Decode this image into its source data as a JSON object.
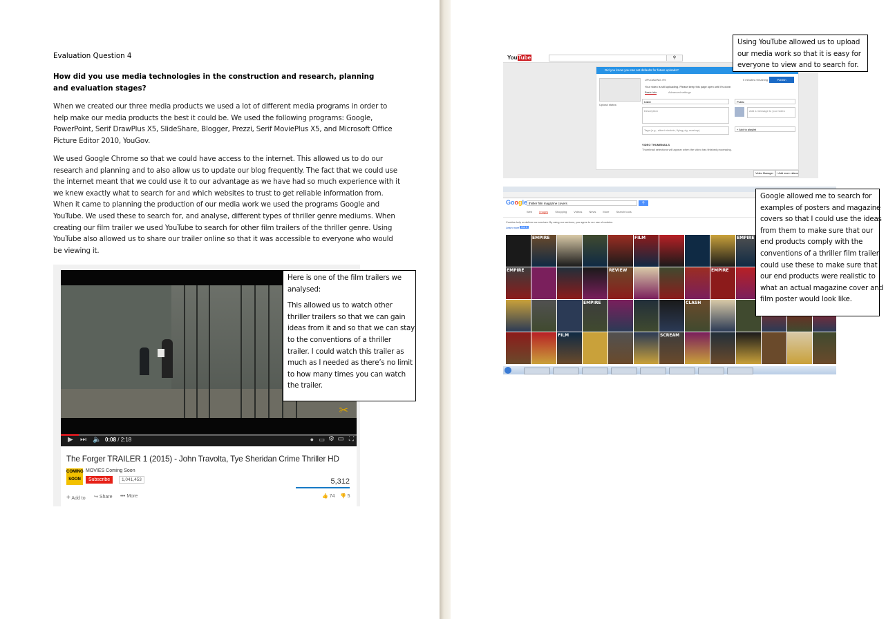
{
  "document": {
    "left_page": {
      "title": "Evaluation Question 4",
      "question": "How did you use media technologies in the construction and research, planning and evaluation stages?",
      "paragraph_1": [
        "When we created our three media products we used a lot of different media programs in order to",
        "help make our media products the best it could be. We used the following programs: Google,",
        "PowerPoint, Serif DrawPlus X5, SlideShare, Blogger, Prezzi, Serif MoviePlus X5, and Microsoft Office",
        "Picture Editor 2010, YouGov."
      ],
      "paragraph_2": [
        "We used Google Chrome so that we could have access to the internet. This allowed us to do our",
        "research and planning and to also allow us to update our blog frequently. The fact that we could use",
        "the internet meant that we could use it to our advantage as we have had so much experience with it",
        "we knew exactly what to search for and which websites to trust to get reliable information from.",
        "When it came to planning the production of our media work we used the programs Google and",
        "YouTube. We used these to search for, and analyse, different types of thriller genre mediums. When",
        "creating our film trailer we used YouTube to search for other film trailers of the thriller genre. Using",
        "YouTube also allowed us to share our trailer online so that it was accessible to everyone who would",
        "be viewing it."
      ],
      "trailer_note": {
        "intro": [
          "Here is one of the film trailers we",
          "analysed:"
        ],
        "body": [
          "This allowed us to watch other",
          "thriller trailers so that we can gain",
          "ideas from it and so that we can stay",
          "to the conventions of a thriller",
          "trailer. I could watch this trailer as",
          "much as I needed as there’s no limit",
          "to how many times you can watch",
          "the trailer."
        ]
      },
      "video": {
        "title": "The Forger TRAILER 1 (2015) - John Travolta, Tye Sheridan Crime Thriller HD",
        "channel": "MOVIES Coming Soon",
        "channel_logo_top": "COMING",
        "channel_logo_bottom": "SOON",
        "subscribe_label": "Subscribe",
        "subscriber_count": "1,041,453",
        "view_count": "5,312",
        "time_current": "0:08",
        "time_total": "2:18",
        "progress_fraction": 0.06,
        "likes": "74",
        "dislikes": "5",
        "add_to_label": "Add to",
        "share_label": "Share",
        "more_label": "More"
      }
    },
    "right_page": {
      "youtube_note": [
        "Using YouTube allowed us to upload",
        "our media work so that it is easy for",
        "everyone to view and to search for."
      ],
      "google_note": [
        "Google allowed me to search for",
        "examples of posters and magazine",
        "covers so that I could use the ideas",
        "from them to make sure that our",
        "end products comply with the",
        "conventions of a thriller film trailer.",
        "could use these to make sure that",
        "our end products were realistic to",
        "what an actual magazine cover and",
        "film poster would look like."
      ],
      "youtube_upload": {
        "banner": "Did you know you can set defaults for future uploads?",
        "status": "UPLOADING 4%",
        "notice": "Your video is still uploading. Please keep this page open until it’s done.",
        "time_remaining": "5 minutes remaining",
        "publish_label": "Publish",
        "tab_basic": "Basic info",
        "tab_advanced": "Advanced settings",
        "title_value": "trailer",
        "description_placeholder": "Description",
        "tags_placeholder": "Tags (e.g., albert einstein, flying pig, mashup)",
        "privacy_value": "Public",
        "message_placeholder": "Add a message to your video",
        "add_to_playlist": "+ Add to playlist",
        "thumbnails_label": "VIDEO THUMBNAILS",
        "thumbnails_note": "Thumbnail selections will appear when the video has finished processing.",
        "upload_status_label": "Upload status:",
        "video_manager": "Video Manager",
        "add_more": "+ Add more videos"
      },
      "google_search": {
        "query": "thriller film magazine covers",
        "tabs": [
          "Web",
          "Images",
          "Shopping",
          "Videos",
          "News",
          "More",
          "Search tools"
        ],
        "cookie_notice": "Cookies help us deliver our services. By using our services, you agree to our use of cookies.",
        "cookie_learn": "Learn more",
        "cookie_ok": "Got it",
        "tile_words": [
          "EMPIRE",
          "FILM",
          "EMPIRE",
          "EMPIRE",
          "REVIEW",
          "EMPIRE",
          "SCREEN",
          "EMPIRE",
          "CLASH",
          "EMPIRE",
          "FILM",
          "SCREAM"
        ]
      }
    }
  },
  "colors": {
    "youtube_red": "#cc181e",
    "google_blue": "#1a73e8",
    "publish_blue": "#1b6ac6",
    "page_gutter": "#d9d2c4"
  }
}
